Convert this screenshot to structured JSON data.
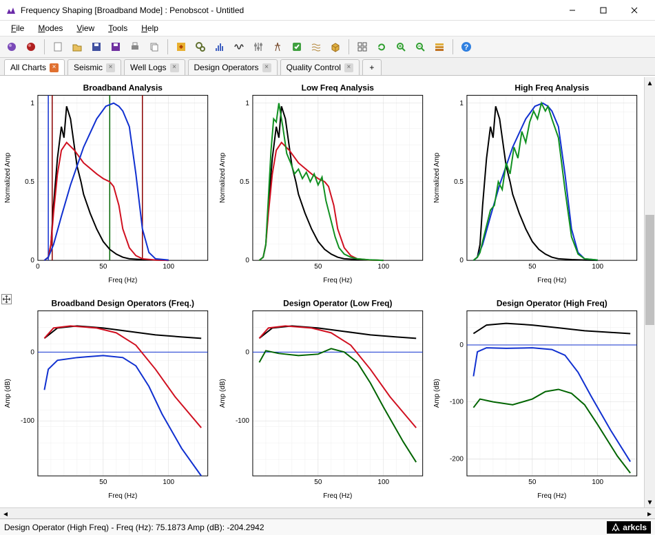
{
  "window": {
    "title": "Frequency Shaping [Broadband Mode] : Penobscot - Untitled"
  },
  "menu": {
    "items": [
      "File",
      "Modes",
      "View",
      "Tools",
      "Help"
    ]
  },
  "tabs": {
    "items": [
      {
        "label": "All Charts",
        "active": true
      },
      {
        "label": "Seismic",
        "active": false
      },
      {
        "label": "Well Logs",
        "active": false
      },
      {
        "label": "Design Operators",
        "active": false
      },
      {
        "label": "Quality Control",
        "active": false
      }
    ]
  },
  "status": {
    "text": "Design Operator (High Freq)  -  Freq (Hz): 75.1873  Amp (dB): -204.2942",
    "brand": "arkcls"
  },
  "colors": {
    "black": "#000000",
    "red": "#d01020",
    "blue": "#1030d0",
    "green": "#109020",
    "darkgreen": "#006400"
  },
  "chart_data": [
    {
      "title": "Broadband Analysis",
      "xlabel": "Freq (Hz)",
      "ylabel": "Normalized Amp",
      "xlim": [
        0,
        130
      ],
      "ylim": [
        0,
        1.05
      ],
      "xticks": [
        0,
        50,
        100
      ],
      "yticks": [
        0,
        0.5,
        1
      ],
      "vlines": [
        {
          "x": 8,
          "color": "blue"
        },
        {
          "x": 11,
          "color": "darkred"
        },
        {
          "x": 55,
          "color": "darkgreen"
        },
        {
          "x": 80,
          "color": "darkred"
        }
      ],
      "series": [
        {
          "name": "black",
          "color": "black",
          "x": [
            5,
            8,
            10,
            12,
            15,
            18,
            20,
            22,
            25,
            28,
            30,
            33,
            35,
            40,
            45,
            50,
            55,
            60,
            65,
            70,
            80,
            90,
            100
          ],
          "y": [
            0,
            0.02,
            0.1,
            0.35,
            0.65,
            0.85,
            0.78,
            0.98,
            0.9,
            0.72,
            0.6,
            0.5,
            0.42,
            0.3,
            0.2,
            0.12,
            0.07,
            0.04,
            0.02,
            0.01,
            0.005,
            0.002,
            0
          ]
        },
        {
          "name": "red",
          "color": "red",
          "x": [
            5,
            8,
            10,
            12,
            15,
            18,
            22,
            28,
            35,
            45,
            50,
            55,
            58,
            62,
            65,
            70,
            75,
            80,
            90,
            100
          ],
          "y": [
            0,
            0.02,
            0.1,
            0.3,
            0.55,
            0.7,
            0.75,
            0.7,
            0.62,
            0.55,
            0.52,
            0.5,
            0.47,
            0.35,
            0.2,
            0.08,
            0.03,
            0.01,
            0.002,
            0
          ]
        },
        {
          "name": "blue",
          "color": "blue",
          "x": [
            5,
            8,
            12,
            18,
            25,
            35,
            45,
            52,
            58,
            62,
            65,
            70,
            75,
            80,
            85,
            90,
            100
          ],
          "y": [
            0,
            0.02,
            0.1,
            0.28,
            0.48,
            0.72,
            0.9,
            0.98,
            1.0,
            0.98,
            0.95,
            0.85,
            0.55,
            0.2,
            0.05,
            0.01,
            0.002
          ]
        }
      ]
    },
    {
      "title": "Low Freq Analysis",
      "xlabel": "Freq (Hz)",
      "ylabel": "Normalized Amp",
      "xlim": [
        0,
        130
      ],
      "ylim": [
        0,
        1.05
      ],
      "xticks": [
        50,
        100
      ],
      "yticks": [
        0,
        0.5,
        1
      ],
      "series": [
        {
          "name": "black",
          "color": "black",
          "x": [
            5,
            8,
            10,
            12,
            15,
            18,
            20,
            22,
            25,
            28,
            30,
            33,
            35,
            40,
            45,
            50,
            55,
            60,
            65,
            70,
            80,
            90,
            100
          ],
          "y": [
            0,
            0.02,
            0.1,
            0.35,
            0.65,
            0.85,
            0.78,
            0.98,
            0.9,
            0.72,
            0.6,
            0.5,
            0.42,
            0.3,
            0.2,
            0.12,
            0.07,
            0.04,
            0.02,
            0.01,
            0.005,
            0.002,
            0
          ]
        },
        {
          "name": "red",
          "color": "red",
          "x": [
            5,
            8,
            10,
            12,
            15,
            18,
            22,
            28,
            35,
            45,
            50,
            55,
            58,
            62,
            65,
            70,
            75,
            80,
            90,
            100
          ],
          "y": [
            0,
            0.02,
            0.1,
            0.3,
            0.55,
            0.7,
            0.75,
            0.7,
            0.62,
            0.55,
            0.52,
            0.5,
            0.47,
            0.35,
            0.2,
            0.08,
            0.03,
            0.01,
            0.002,
            0
          ]
        },
        {
          "name": "green",
          "color": "green",
          "x": [
            5,
            8,
            10,
            12,
            14,
            16,
            18,
            20,
            23,
            26,
            29,
            32,
            35,
            38,
            41,
            44,
            47,
            50,
            53,
            56,
            60,
            63,
            66,
            70,
            75,
            80,
            90,
            100
          ],
          "y": [
            0,
            0.02,
            0.1,
            0.4,
            0.7,
            0.9,
            0.88,
            1.0,
            0.85,
            0.68,
            0.62,
            0.55,
            0.58,
            0.52,
            0.56,
            0.5,
            0.55,
            0.48,
            0.53,
            0.38,
            0.25,
            0.15,
            0.08,
            0.04,
            0.02,
            0.01,
            0.003,
            0
          ]
        }
      ]
    },
    {
      "title": "High Freq Analysis",
      "xlabel": "Freq (Hz)",
      "ylabel": "Normalized Amp",
      "xlim": [
        0,
        130
      ],
      "ylim": [
        0,
        1.05
      ],
      "xticks": [
        50,
        100
      ],
      "yticks": [
        0,
        0.5,
        1
      ],
      "series": [
        {
          "name": "black",
          "color": "black",
          "x": [
            5,
            8,
            10,
            12,
            15,
            18,
            20,
            22,
            25,
            28,
            30,
            33,
            35,
            40,
            45,
            50,
            55,
            60,
            65,
            70,
            80,
            90,
            100
          ],
          "y": [
            0,
            0.02,
            0.1,
            0.35,
            0.65,
            0.85,
            0.78,
            0.98,
            0.9,
            0.72,
            0.6,
            0.5,
            0.42,
            0.3,
            0.2,
            0.12,
            0.07,
            0.04,
            0.02,
            0.01,
            0.005,
            0.002,
            0
          ]
        },
        {
          "name": "blue",
          "color": "blue",
          "x": [
            5,
            8,
            12,
            18,
            25,
            35,
            45,
            52,
            58,
            62,
            65,
            70,
            75,
            80,
            85,
            90,
            100
          ],
          "y": [
            0,
            0.02,
            0.1,
            0.28,
            0.48,
            0.72,
            0.9,
            0.98,
            1.0,
            0.98,
            0.95,
            0.85,
            0.55,
            0.2,
            0.05,
            0.01,
            0.002
          ]
        },
        {
          "name": "green",
          "color": "green",
          "x": [
            5,
            8,
            10,
            12,
            15,
            18,
            21,
            24,
            27,
            30,
            33,
            36,
            39,
            42,
            45,
            48,
            51,
            54,
            57,
            60,
            62,
            65,
            70,
            75,
            80,
            85,
            90,
            100
          ],
          "y": [
            0,
            0.02,
            0.05,
            0.12,
            0.22,
            0.32,
            0.35,
            0.5,
            0.45,
            0.62,
            0.55,
            0.72,
            0.65,
            0.82,
            0.75,
            0.88,
            0.95,
            0.9,
            1.0,
            0.95,
            0.98,
            0.9,
            0.78,
            0.45,
            0.15,
            0.04,
            0.01,
            0.002
          ]
        }
      ]
    },
    {
      "title": "Broadband Design Operators (Freq.)",
      "xlabel": "Freq (Hz)",
      "ylabel": "Amp (dB)",
      "xlim": [
        0,
        130
      ],
      "ylim": [
        -180,
        60
      ],
      "xticks": [
        50,
        100
      ],
      "yticks": [
        -100,
        0
      ],
      "hline": 0,
      "series": [
        {
          "name": "black",
          "color": "black",
          "x": [
            5,
            15,
            30,
            50,
            70,
            90,
            110,
            125
          ],
          "y": [
            20,
            35,
            38,
            35,
            30,
            25,
            22,
            20
          ]
        },
        {
          "name": "red",
          "color": "red",
          "x": [
            5,
            12,
            25,
            45,
            60,
            75,
            90,
            105,
            125
          ],
          "y": [
            20,
            35,
            38,
            35,
            28,
            10,
            -25,
            -65,
            -110
          ]
        },
        {
          "name": "blue",
          "color": "blue",
          "x": [
            5,
            8,
            15,
            30,
            50,
            65,
            75,
            85,
            95,
            110,
            125
          ],
          "y": [
            -55,
            -25,
            -12,
            -8,
            -5,
            -8,
            -20,
            -50,
            -90,
            -140,
            -180
          ]
        }
      ]
    },
    {
      "title": "Design Operator (Low Freq)",
      "xlabel": "Freq (Hz)",
      "ylabel": "Amp (dB)",
      "xlim": [
        0,
        130
      ],
      "ylim": [
        -180,
        60
      ],
      "xticks": [
        50,
        100
      ],
      "yticks": [
        -100,
        0
      ],
      "hline": 0,
      "series": [
        {
          "name": "black",
          "color": "black",
          "x": [
            5,
            15,
            30,
            50,
            70,
            90,
            110,
            125
          ],
          "y": [
            20,
            35,
            38,
            35,
            30,
            25,
            22,
            20
          ]
        },
        {
          "name": "red",
          "color": "red",
          "x": [
            5,
            12,
            25,
            45,
            60,
            75,
            90,
            105,
            125
          ],
          "y": [
            20,
            35,
            38,
            35,
            28,
            10,
            -25,
            -65,
            -110
          ]
        },
        {
          "name": "green",
          "color": "darkgreen",
          "x": [
            5,
            10,
            20,
            35,
            50,
            60,
            70,
            80,
            90,
            100,
            115,
            125
          ],
          "y": [
            -15,
            2,
            -2,
            -5,
            -3,
            5,
            0,
            -15,
            -45,
            -80,
            -130,
            -160
          ]
        }
      ]
    },
    {
      "title": "Design Operator (High Freq)",
      "xlabel": "Freq (Hz)",
      "ylabel": "Amp (dB)",
      "xlim": [
        0,
        130
      ],
      "ylim": [
        -230,
        60
      ],
      "xticks": [
        50,
        100
      ],
      "yticks": [
        -200,
        -100,
        0
      ],
      "hline": 0,
      "series": [
        {
          "name": "black",
          "color": "black",
          "x": [
            5,
            15,
            30,
            50,
            70,
            90,
            110,
            125
          ],
          "y": [
            20,
            35,
            38,
            35,
            30,
            25,
            22,
            20
          ]
        },
        {
          "name": "blue",
          "color": "blue",
          "x": [
            5,
            8,
            15,
            30,
            50,
            65,
            75,
            85,
            95,
            110,
            125
          ],
          "y": [
            -55,
            -12,
            -5,
            -6,
            -5,
            -8,
            -18,
            -48,
            -90,
            -150,
            -205
          ]
        },
        {
          "name": "green",
          "color": "darkgreen",
          "x": [
            5,
            10,
            20,
            35,
            50,
            60,
            70,
            80,
            90,
            100,
            115,
            125
          ],
          "y": [
            -110,
            -95,
            -100,
            -105,
            -95,
            -82,
            -78,
            -85,
            -105,
            -140,
            -195,
            -225
          ]
        }
      ]
    }
  ]
}
